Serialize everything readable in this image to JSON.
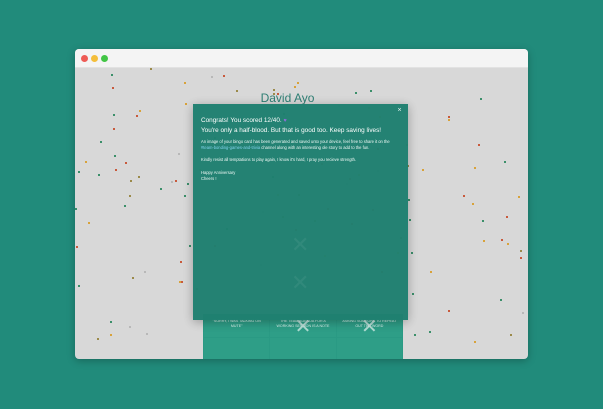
{
  "page": {
    "name": "David Ayo"
  },
  "modal": {
    "heading": "Congrats! You scored 12/40.",
    "heart_icon": "purple-heart-icon",
    "subheading": "You're only a half-blood. But that is good too. Keep saving lives!",
    "body_pre": "An image of your bingo card has been generated and saved unto your device, feel free to share it on the ",
    "channel": "#team-bonding-games-and-trivia",
    "body_post": " channel along with an interesting ole story to add to the fun.",
    "paragraph2": "Kindly resist all temptations to play again, I know it's hard, I pray you recieve strength.",
    "signoff_line1": "Happy Anniversary",
    "signoff_line2": "Cheers !",
    "close_label": "×"
  },
  "bingo": {
    "cells": [
      {
        "text": "\"SORRY, I WAS TALKING ON MUTE\"",
        "marked": false
      },
      {
        "text": "THE TEAM AGENDA FOR A WORKING SESSION IS A NOTE",
        "marked": true
      },
      {
        "text": "ASKING SOMEONE TO REPEAT OUT THE WORD",
        "marked": true
      },
      {
        "text": "",
        "marked": false
      },
      {
        "text": "",
        "marked": false
      },
      {
        "text": "",
        "marked": false
      }
    ]
  },
  "colors": {
    "background": "#218b7b",
    "modal": "#1f8070",
    "link": "#7fd3ee",
    "heart": "#8e6ad8"
  }
}
